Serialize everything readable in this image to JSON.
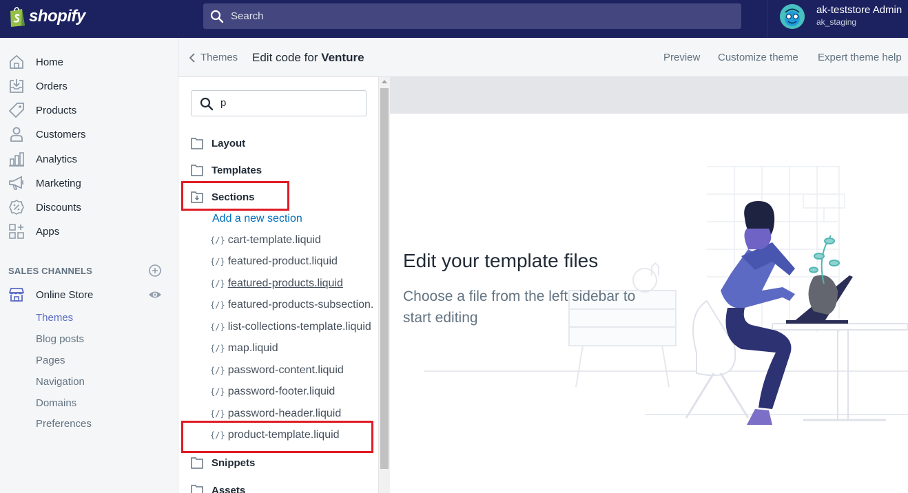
{
  "topbar": {
    "logo_text": "shopify",
    "search_placeholder": "Search",
    "account_name": "ak-teststore Admin",
    "account_store": "ak_staging"
  },
  "nav": {
    "items": [
      {
        "label": "Home",
        "icon": "home-icon"
      },
      {
        "label": "Orders",
        "icon": "orders-icon"
      },
      {
        "label": "Products",
        "icon": "tag-icon"
      },
      {
        "label": "Customers",
        "icon": "person-icon"
      },
      {
        "label": "Analytics",
        "icon": "bar-chart-icon"
      },
      {
        "label": "Marketing",
        "icon": "megaphone-icon"
      },
      {
        "label": "Discounts",
        "icon": "discount-icon"
      },
      {
        "label": "Apps",
        "icon": "apps-icon"
      }
    ],
    "sales_channels_label": "SALES CHANNELS",
    "online_store_label": "Online Store",
    "sub_items": [
      "Themes",
      "Blog posts",
      "Pages",
      "Navigation",
      "Domains",
      "Preferences"
    ],
    "active_sub": "Themes"
  },
  "header": {
    "back_label": "Themes",
    "edit_prefix": "Edit code for",
    "theme_name": "Venture",
    "links": [
      "Preview",
      "Customize theme",
      "Expert theme help"
    ]
  },
  "filetree": {
    "search_value": "p",
    "folders": {
      "layout": "Layout",
      "templates": "Templates",
      "sections": "Sections",
      "snippets": "Snippets",
      "assets": "Assets"
    },
    "add_section_label": "Add a new section",
    "brace_glyph": "{/}",
    "section_files": [
      "cart-template.liquid",
      "featured-product.liquid",
      "featured-products.liquid",
      "featured-products-subsection.",
      "list-collections-template.liquid",
      "map.liquid",
      "password-content.liquid",
      "password-footer.liquid",
      "password-header.liquid",
      "product-template.liquid"
    ]
  },
  "editor": {
    "heading": "Edit your template files",
    "subtext": "Choose a file from the left sidebar to start editing"
  },
  "colors": {
    "topbar": "#1c2260",
    "accent": "#5c6ac4",
    "link": "#006fbb",
    "highlight_box": "#e01b24"
  }
}
